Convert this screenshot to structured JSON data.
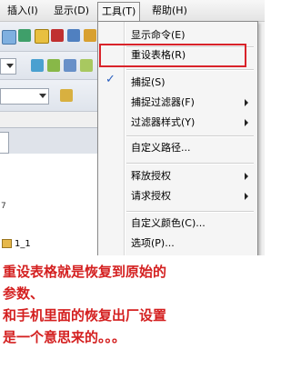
{
  "menubar": {
    "items": [
      {
        "label": "插入(I)"
      },
      {
        "label": "显示(D)"
      },
      {
        "label": "工具(T)"
      },
      {
        "label": "帮助(H)"
      }
    ]
  },
  "dropdown": {
    "items": [
      {
        "label": "显示命令(E)"
      },
      {
        "label": "重设表格(R)"
      },
      {
        "label": "捕捉(S)"
      },
      {
        "label": "捕捉过滤器(F)"
      },
      {
        "label": "过滤器样式(Y)"
      },
      {
        "label": "自定义路径..."
      },
      {
        "label": "释放授权"
      },
      {
        "label": "请求授权"
      },
      {
        "label": "自定义颜色(C)..."
      },
      {
        "label": "选项(P)..."
      }
    ],
    "check_mark": "✓"
  },
  "tree": {
    "node_label": "1_1",
    "mark": "7"
  },
  "caption": {
    "lines": [
      "重设表格就是恢复到原始的",
      "参数、",
      "和手机里面的恢复出厂设置",
      "是一个意思来的。。。"
    ]
  },
  "colors": {
    "highlight": "#d9232a",
    "caption": "#d42020",
    "check": "#2a5fbf"
  }
}
